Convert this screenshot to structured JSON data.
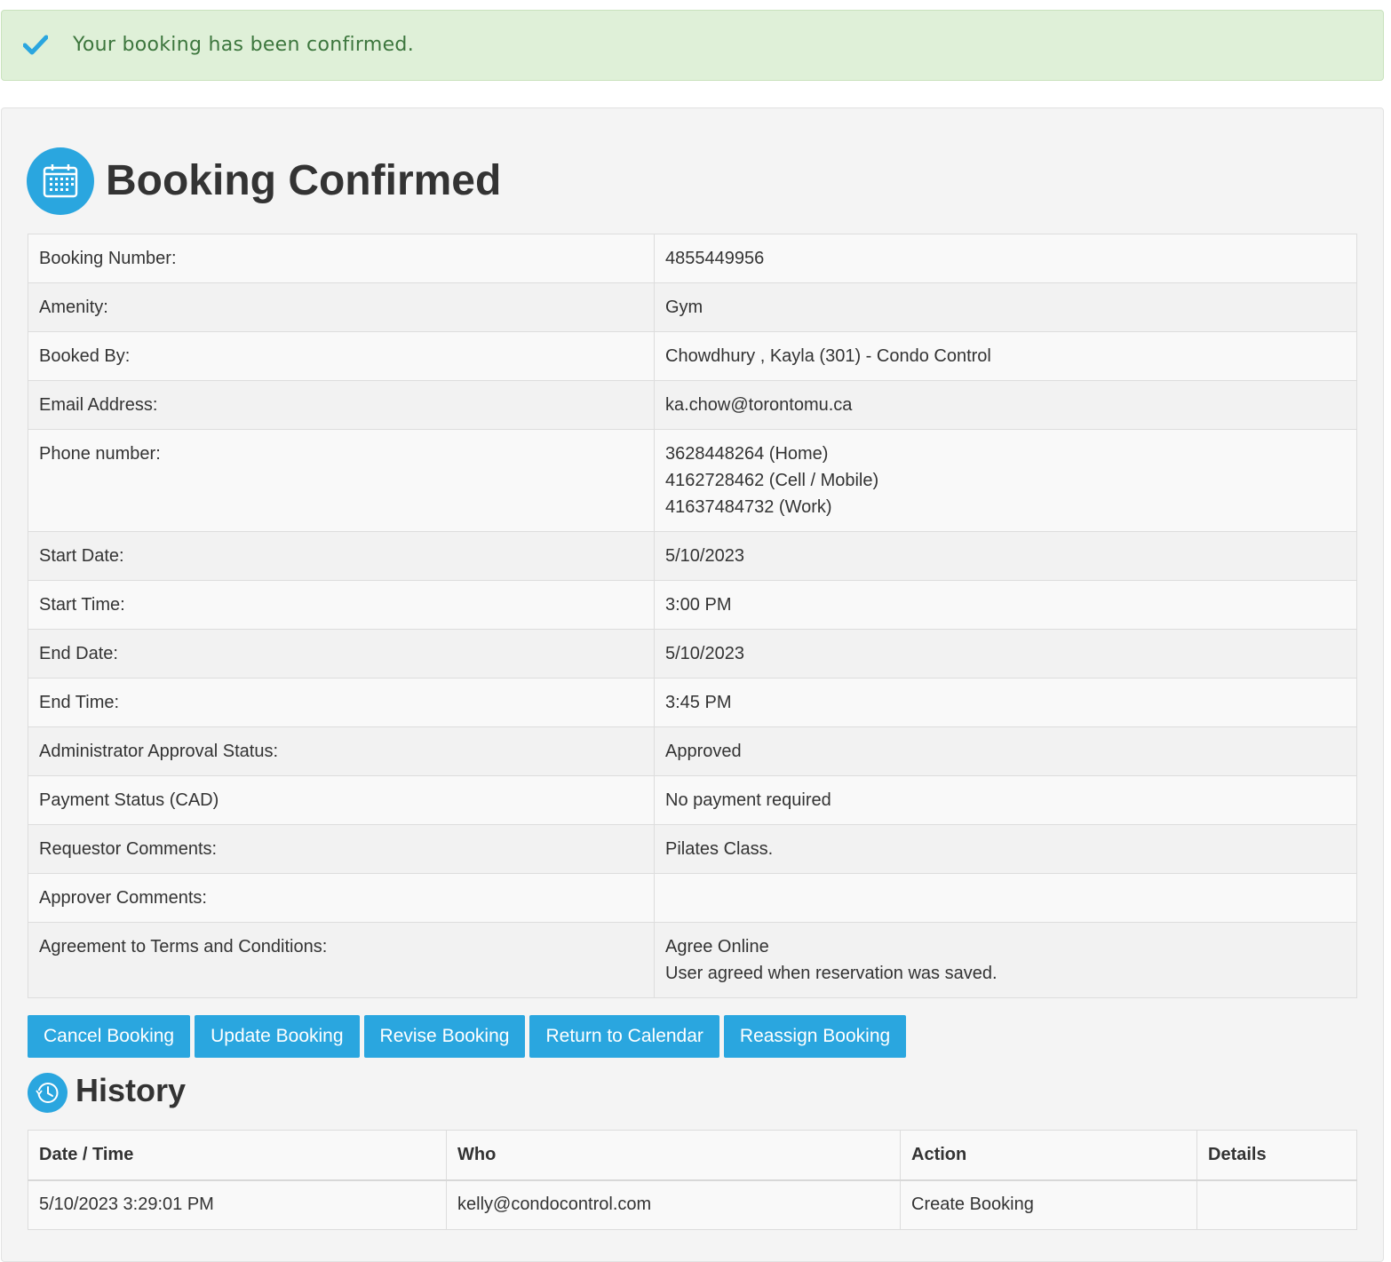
{
  "alert": {
    "message": "Your booking has been confirmed.",
    "icon": "check-icon",
    "color": "#3c763d"
  },
  "header": {
    "title": "Booking Confirmed",
    "icon": "calendar-icon"
  },
  "details": [
    {
      "label": "Booking Number:",
      "value": "4855449956"
    },
    {
      "label": "Amenity:",
      "value": "Gym"
    },
    {
      "label": "Booked By:",
      "value": "Chowdhury , Kayla (301) - Condo Control"
    },
    {
      "label": "Email Address:",
      "value": "ka.chow@torontomu.ca"
    },
    {
      "label": "Phone number:",
      "lines": [
        "3628448264 (Home)",
        "4162728462 (Cell / Mobile)",
        "41637484732 (Work)"
      ]
    },
    {
      "label": "Start Date:",
      "value": "5/10/2023"
    },
    {
      "label": "Start Time:",
      "value": "3:00 PM"
    },
    {
      "label": "End Date:",
      "value": "5/10/2023"
    },
    {
      "label": "End Time:",
      "value": "3:45 PM"
    },
    {
      "label": "Administrator Approval Status:",
      "value": "Approved"
    },
    {
      "label": "Payment Status (CAD)",
      "value": "No payment required"
    },
    {
      "label": "Requestor Comments:",
      "value": "Pilates Class."
    },
    {
      "label": "Approver Comments:",
      "value": ""
    },
    {
      "label": "Agreement to Terms and Conditions:",
      "lines": [
        "Agree Online",
        "User agreed when reservation was saved."
      ]
    }
  ],
  "buttons": {
    "cancel": "Cancel Booking",
    "update": "Update Booking",
    "revise": "Revise Booking",
    "return": "Return to Calendar",
    "reassign": "Reassign Booking"
  },
  "history": {
    "title": "History",
    "icon": "history-icon",
    "columns": [
      "Date / Time",
      "Who",
      "Action",
      "Details"
    ],
    "rows": [
      [
        "5/10/2023 3:29:01 PM",
        "kelly@condocontrol.com",
        "Create Booking",
        ""
      ]
    ]
  },
  "colors": {
    "accent": "#2aa6df",
    "alert_bg": "#dff0d8"
  }
}
